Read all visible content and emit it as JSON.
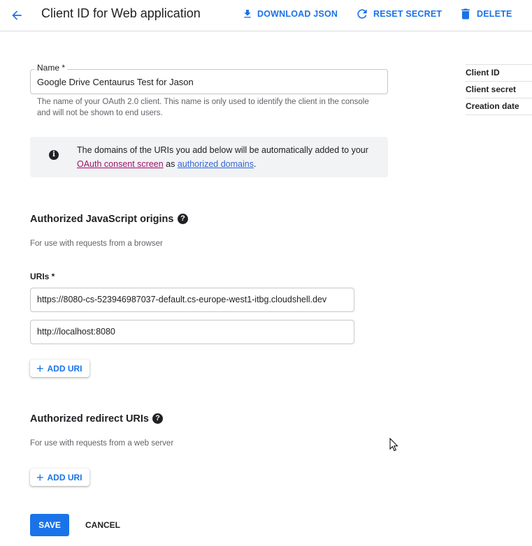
{
  "header": {
    "title": "Client ID for Web application",
    "actions": {
      "download": "DOWNLOAD JSON",
      "reset": "RESET SECRET",
      "delete": "DELETE"
    }
  },
  "form": {
    "name_label": "Name *",
    "name_value": "Google Drive Centaurus Test for Jason",
    "name_help": "The name of your OAuth 2.0 client. This name is only used to identify the client in the console and will not be shown to end users."
  },
  "info": {
    "text_before": "The domains of the URIs you add below will be automatically added to your ",
    "consent_link": "OAuth consent screen",
    "text_middle": " as ",
    "domains_link": "authorized domains",
    "text_after": "."
  },
  "js_origins": {
    "title": "Authorized JavaScript origins",
    "subtitle": "For use with requests from a browser",
    "uris_label": "URIs *",
    "uris": [
      "https://8080-cs-523946987037-default.cs-europe-west1-itbg.cloudshell.dev",
      "http://localhost:8080"
    ],
    "add_label": "ADD URI"
  },
  "redirect": {
    "title": "Authorized redirect URIs",
    "subtitle": "For use with requests from a web server",
    "add_label": "ADD URI"
  },
  "footer": {
    "save": "SAVE",
    "cancel": "CANCEL"
  },
  "side_panel": {
    "rows": [
      "Client ID",
      "Client secret",
      "Creation date"
    ]
  },
  "colors": {
    "accent": "#1a73e8",
    "consent_link": "#a1116a",
    "domains_link": "#3367d6",
    "info_bg": "#f1f3f4"
  }
}
